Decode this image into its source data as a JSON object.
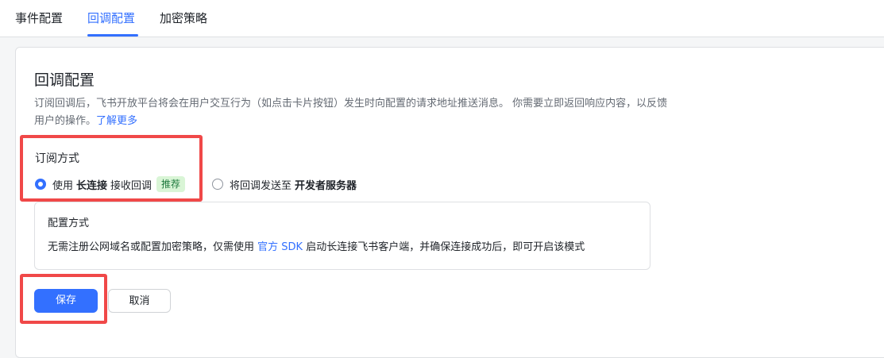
{
  "tabs": [
    {
      "label": "事件配置",
      "active": false
    },
    {
      "label": "回调配置",
      "active": true
    },
    {
      "label": "加密策略",
      "active": false
    }
  ],
  "section": {
    "title": "回调配置",
    "description": "订阅回调后，飞书开放平台将会在用户交互行为（如点击卡片按钮）发生时向配置的请求地址推送消息。 你需要立即返回响应内容，以反馈用户的操作。",
    "learn_more": "了解更多"
  },
  "subscription": {
    "title": "订阅方式",
    "option1": {
      "prefix": "使用",
      "bold": "长连接",
      "suffix": "接收回调",
      "badge": "推荐",
      "selected": true
    },
    "option2": {
      "prefix": "将回调发送至",
      "bold": "开发者服务器",
      "selected": false
    }
  },
  "config": {
    "title": "配置方式",
    "text_before": "无需注册公网域名或配置加密策略，仅需使用",
    "link": "官方 SDK",
    "text_after": "启动长连接飞书客户端，并确保连接成功后，即可开启该模式"
  },
  "buttons": {
    "save": "保存",
    "cancel": "取消"
  },
  "colors": {
    "accent": "#3370ff",
    "highlight": "#f04848",
    "badge_bg": "#d9f5d6",
    "badge_text": "#1f7a3e"
  }
}
